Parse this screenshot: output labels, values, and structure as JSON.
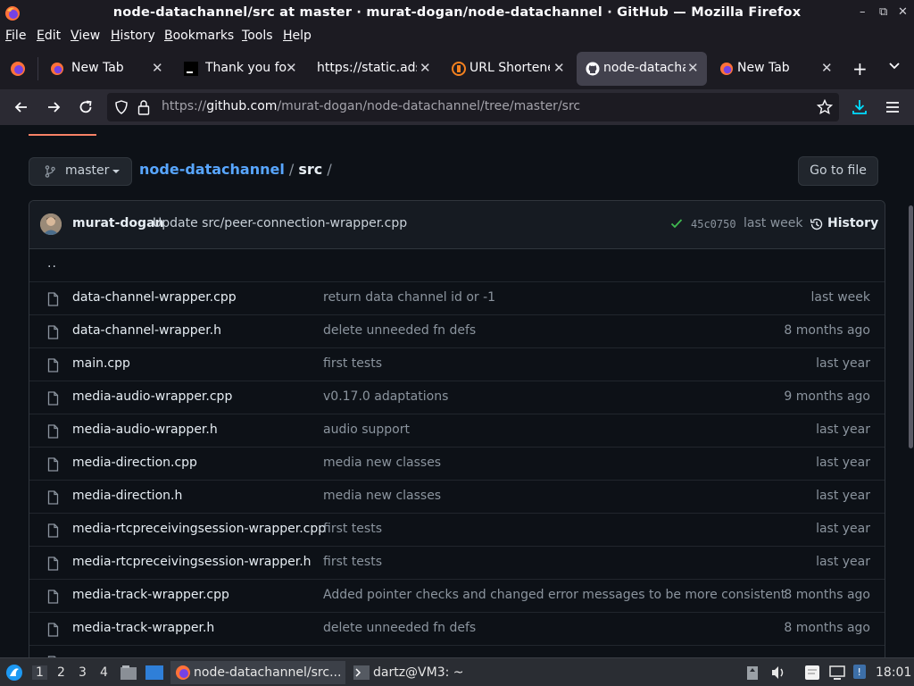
{
  "window": {
    "title": "node-datachannel/src at master · murat-dogan/node-datachannel · GitHub — Mozilla Firefox",
    "controls": [
      "–",
      "⧉",
      "✕"
    ]
  },
  "menu": [
    {
      "label": "File",
      "key": "F"
    },
    {
      "label": "Edit",
      "key": "E"
    },
    {
      "label": "View",
      "key": "V"
    },
    {
      "label": "History",
      "key": "H"
    },
    {
      "label": "Bookmarks",
      "key": "B"
    },
    {
      "label": "Tools",
      "key": "T"
    },
    {
      "label": "Help",
      "key": "H"
    }
  ],
  "tabs": [
    {
      "label": "New Tab",
      "icon": "firefox-icon",
      "active": false
    },
    {
      "label": "Thank you for",
      "icon": "terminal-icon",
      "active": false
    },
    {
      "label": "https://static.ads",
      "icon": "none",
      "active": false
    },
    {
      "label": "URL Shortene",
      "icon": "url-shortener-icon",
      "active": false
    },
    {
      "label": "node-datacha",
      "icon": "github-icon",
      "active": true
    },
    {
      "label": "New Tab",
      "icon": "firefox-icon",
      "active": false
    }
  ],
  "tab_close": "✕",
  "new_tab": "+",
  "address": {
    "prefix": "https://",
    "host": "github.com",
    "path": "/murat-dogan/node-datachannel/tree/master/src"
  },
  "repo": {
    "branch": "master",
    "name": "node-datachannel",
    "sep1": " / ",
    "dir": "src",
    "sep2": " /",
    "goto_file": "Go to file"
  },
  "commit": {
    "author": "murat-dogan",
    "message": "Update src/peer-connection-wrapper.cpp",
    "sha": "45c0750",
    "when": "last week",
    "history_label": "History"
  },
  "parent_dir": "..",
  "files": [
    {
      "name": "data-channel-wrapper.cpp",
      "message": "return data channel id or -1",
      "age": "last week"
    },
    {
      "name": "data-channel-wrapper.h",
      "message": "delete unneeded fn defs",
      "age": "8 months ago"
    },
    {
      "name": "main.cpp",
      "message": "first tests",
      "age": "last year"
    },
    {
      "name": "media-audio-wrapper.cpp",
      "message": "v0.17.0 adaptations",
      "age": "9 months ago"
    },
    {
      "name": "media-audio-wrapper.h",
      "message": "audio support",
      "age": "last year"
    },
    {
      "name": "media-direction.cpp",
      "message": "media new classes",
      "age": "last year"
    },
    {
      "name": "media-direction.h",
      "message": "media new classes",
      "age": "last year"
    },
    {
      "name": "media-rtcpreceivingsession-wrapper.cpp",
      "message": "first tests",
      "age": "last year"
    },
    {
      "name": "media-rtcpreceivingsession-wrapper.h",
      "message": "first tests",
      "age": "last year"
    },
    {
      "name": "media-track-wrapper.cpp",
      "message": "Added pointer checks and changed error messages to be more consistent",
      "age": "8 months ago"
    },
    {
      "name": "media-track-wrapper.h",
      "message": "delete unneeded fn defs",
      "age": "8 months ago"
    },
    {
      "name": "",
      "message": "",
      "age": ""
    }
  ],
  "taskbar": {
    "workspaces": [
      "1",
      "2",
      "3",
      "4"
    ],
    "tasks": [
      {
        "label": "node-datachannel/src...",
        "icon": "firefox-icon",
        "active": true
      },
      {
        "label": "dartz@VM3: ~",
        "icon": "terminal-icon",
        "active": false
      }
    ],
    "clock": "18:01"
  },
  "colors": {
    "link": "#58a6ff",
    "muted": "#8b949e",
    "success": "#3fb950",
    "accent_underline": "#f78166",
    "download": "#0df"
  }
}
